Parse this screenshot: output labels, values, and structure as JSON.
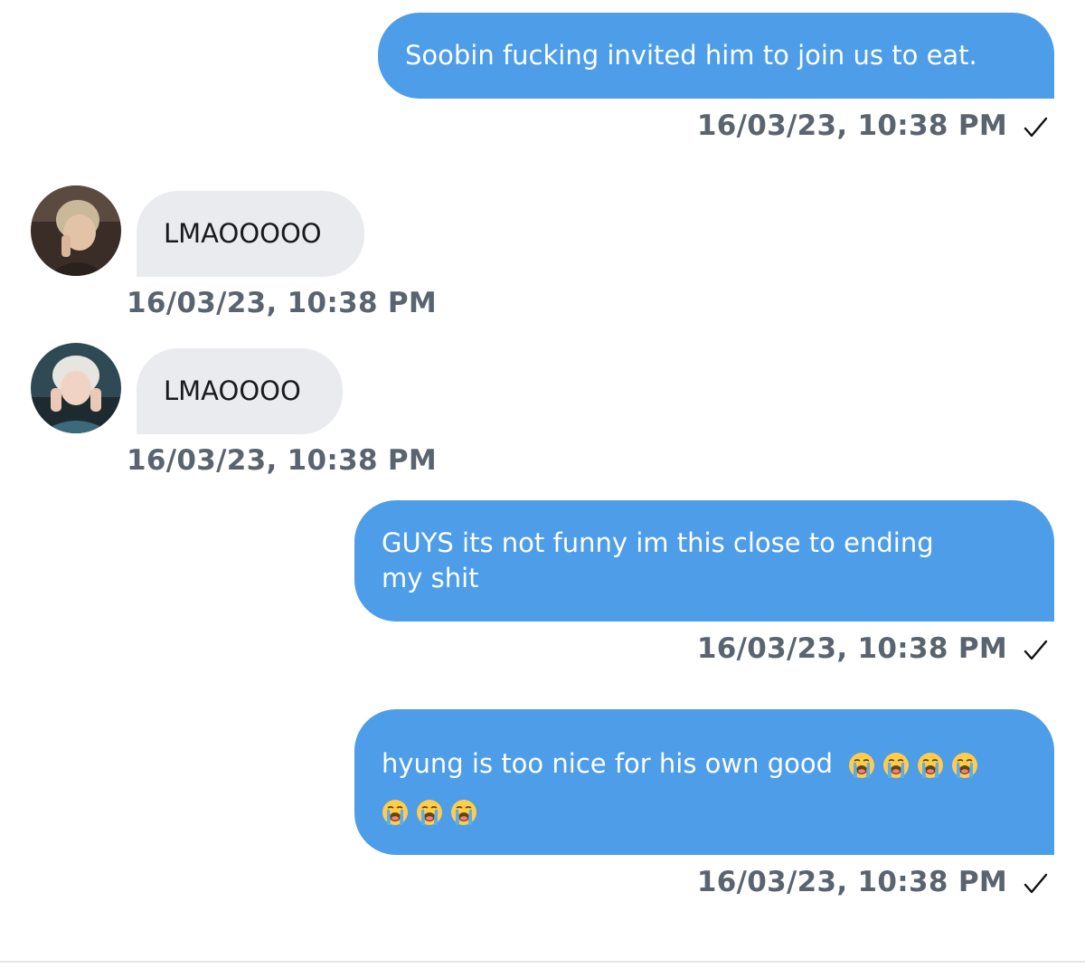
{
  "messages": [
    {
      "direction": "outgoing",
      "text": "Soobin fucking invited him to join us to eat.",
      "timestamp": "16/03/23, 10:38 PM",
      "status_icon": "check-icon"
    },
    {
      "direction": "incoming",
      "avatar": "avatar-user-1",
      "text": "LMAOOOOO",
      "timestamp": "16/03/23, 10:38 PM"
    },
    {
      "direction": "incoming",
      "avatar": "avatar-user-2",
      "text": "LMAOOOO",
      "timestamp": "16/03/23, 10:38 PM"
    },
    {
      "direction": "outgoing",
      "text_line1": "GUYS its not funny im this close to ending",
      "text_line2": "my shit",
      "timestamp": "16/03/23, 10:38 PM",
      "status_icon": "check-icon"
    },
    {
      "direction": "outgoing",
      "text": "hyung is too nice for his own good",
      "emoji": "loudly-crying-face",
      "emoji_count": 7,
      "timestamp": "16/03/23, 10:38 PM",
      "status_icon": "check-icon"
    }
  ],
  "colors": {
    "outgoing_bubble": "#4d9de8",
    "incoming_bubble": "#e9ebef",
    "timestamp": "#5a6470",
    "background": "#ffffff"
  }
}
